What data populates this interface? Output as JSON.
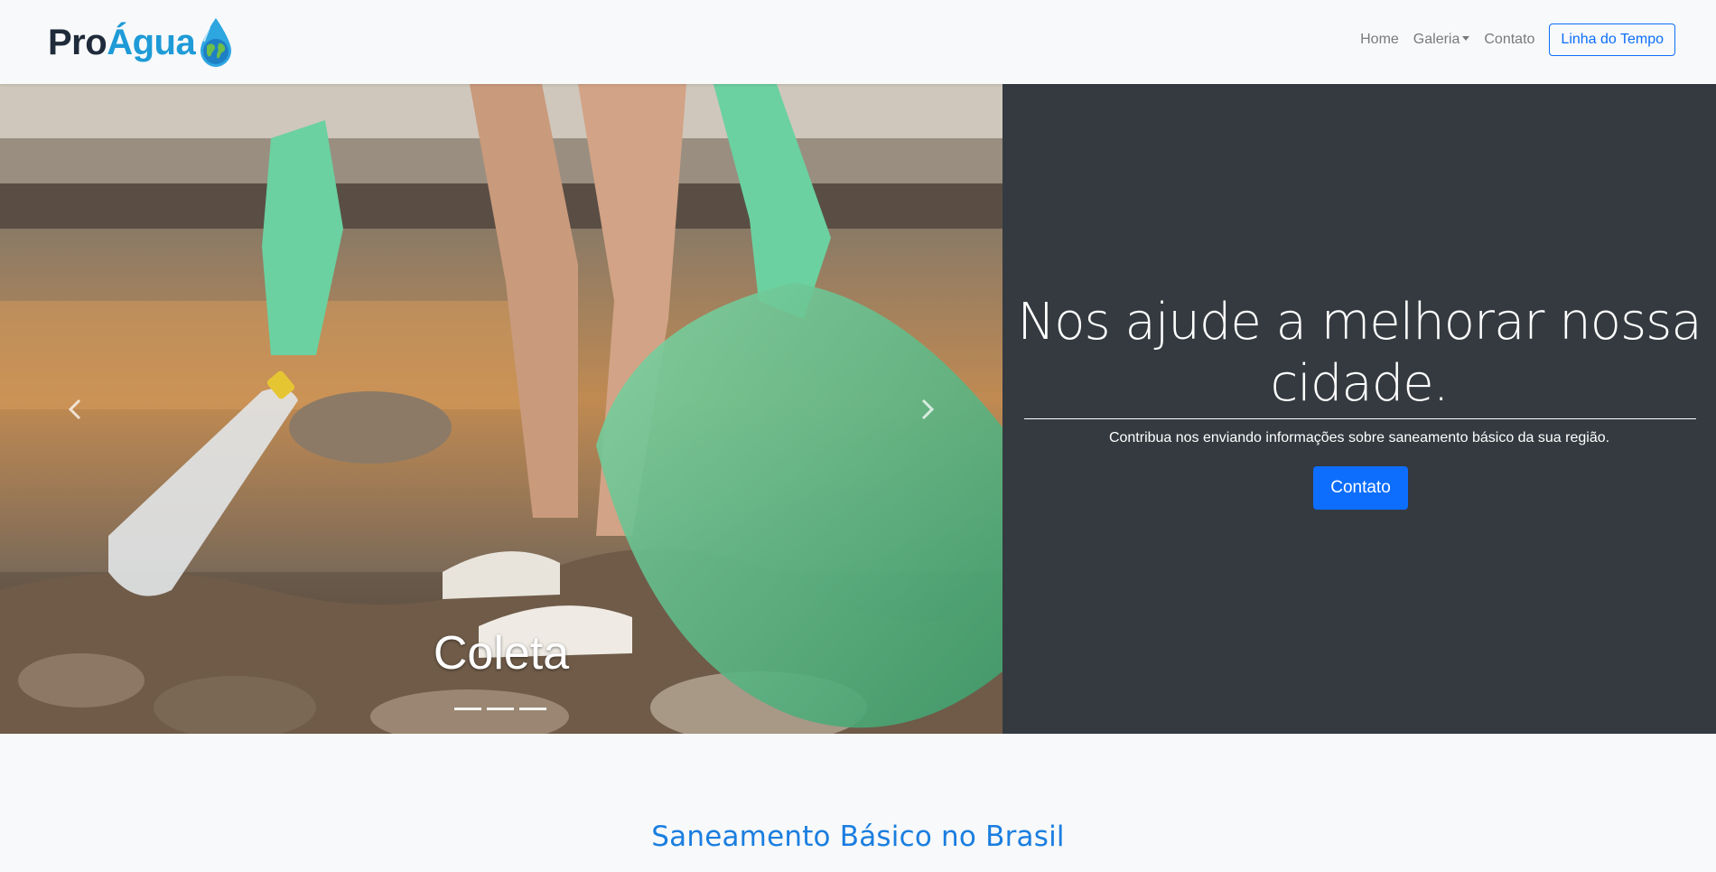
{
  "brand": {
    "pro": "Pro",
    "agua": "Água"
  },
  "nav": {
    "home": "Home",
    "galeria": "Galeria",
    "contato": "Contato",
    "timeline_button": "Linha do Tempo"
  },
  "carousel": {
    "caption": "Coleta",
    "indicator_count": 3,
    "prev_icon": "chevron-left-icon",
    "next_icon": "chevron-right-icon"
  },
  "hero": {
    "heading": "Nos ajude a melhorar nossa cidade.",
    "subtext": "Contribua nos enviando informações sobre saneamento básico da sua região.",
    "button": "Contato"
  },
  "section": {
    "title": "Saneamento Básico no Brasil"
  },
  "colors": {
    "primary": "#0d6efd",
    "panel": "#343a40",
    "navbar": "#f8f9fa",
    "brand_dark": "#1f2b3a",
    "brand_blue": "#1e9bd7"
  }
}
